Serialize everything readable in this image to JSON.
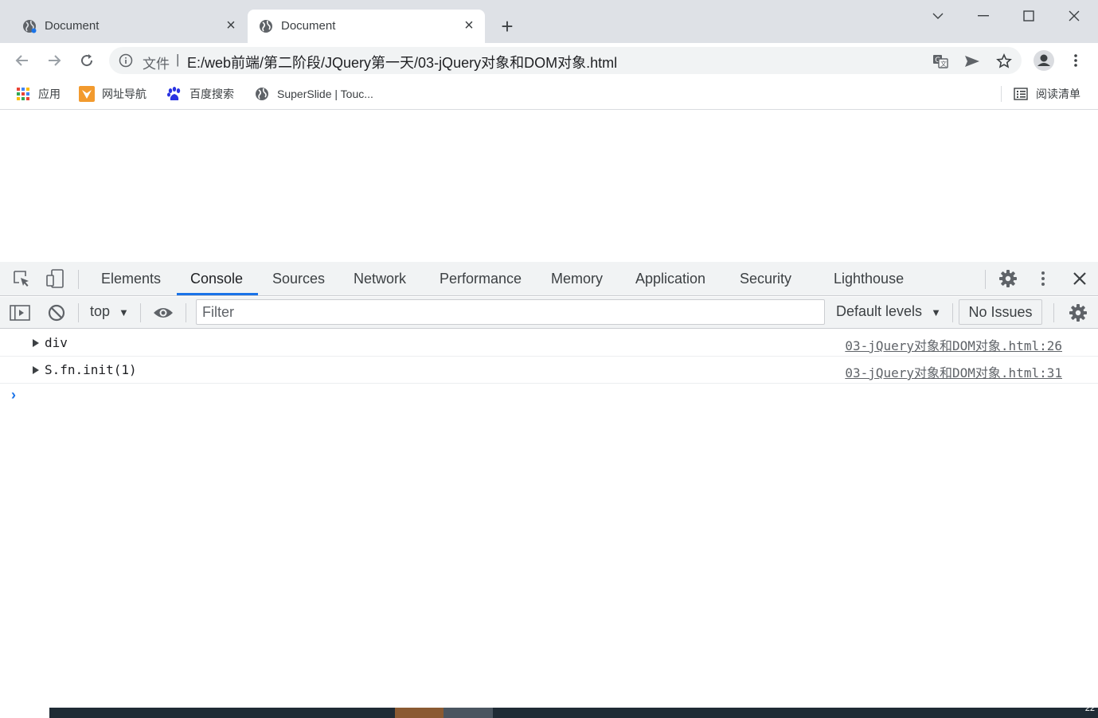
{
  "tabs": [
    {
      "title": "Document",
      "active": false
    },
    {
      "title": "Document",
      "active": true
    }
  ],
  "toolbar": {
    "scheme_label": "文件",
    "separator": "|",
    "url": "E:/web前端/第二阶段/JQuery第一天/03-jQuery对象和DOM对象.html"
  },
  "bookmarks": {
    "items": [
      {
        "label": "应用",
        "icon": "apps-grid-icon"
      },
      {
        "label": "网址导航",
        "icon": "nav-favicon"
      },
      {
        "label": "百度搜索",
        "icon": "baidu-paw-icon"
      },
      {
        "label": "SuperSlide | Touc...",
        "icon": "globe-icon"
      }
    ],
    "reading_list": "阅读清单"
  },
  "devtools": {
    "tabs": [
      "Elements",
      "Console",
      "Sources",
      "Network",
      "Performance",
      "Memory",
      "Application",
      "Security",
      "Lighthouse"
    ],
    "active_tab": "Console",
    "console": {
      "context": "top",
      "filter_placeholder": "Filter",
      "levels": "Default levels",
      "issues": "No Issues",
      "prompt": "›",
      "messages": [
        {
          "text": "div",
          "source": "03-jQuery对象和DOM对象.html:26"
        },
        {
          "text": "S.fn.init(1)",
          "source": "03-jQuery对象和DOM对象.html:31"
        }
      ]
    }
  },
  "taskbar": {
    "clock_fragment": "22"
  },
  "colors": {
    "tabstrip": "#dee1e6",
    "accent": "#1a73e8",
    "devtools_bar": "#f1f3f4"
  }
}
